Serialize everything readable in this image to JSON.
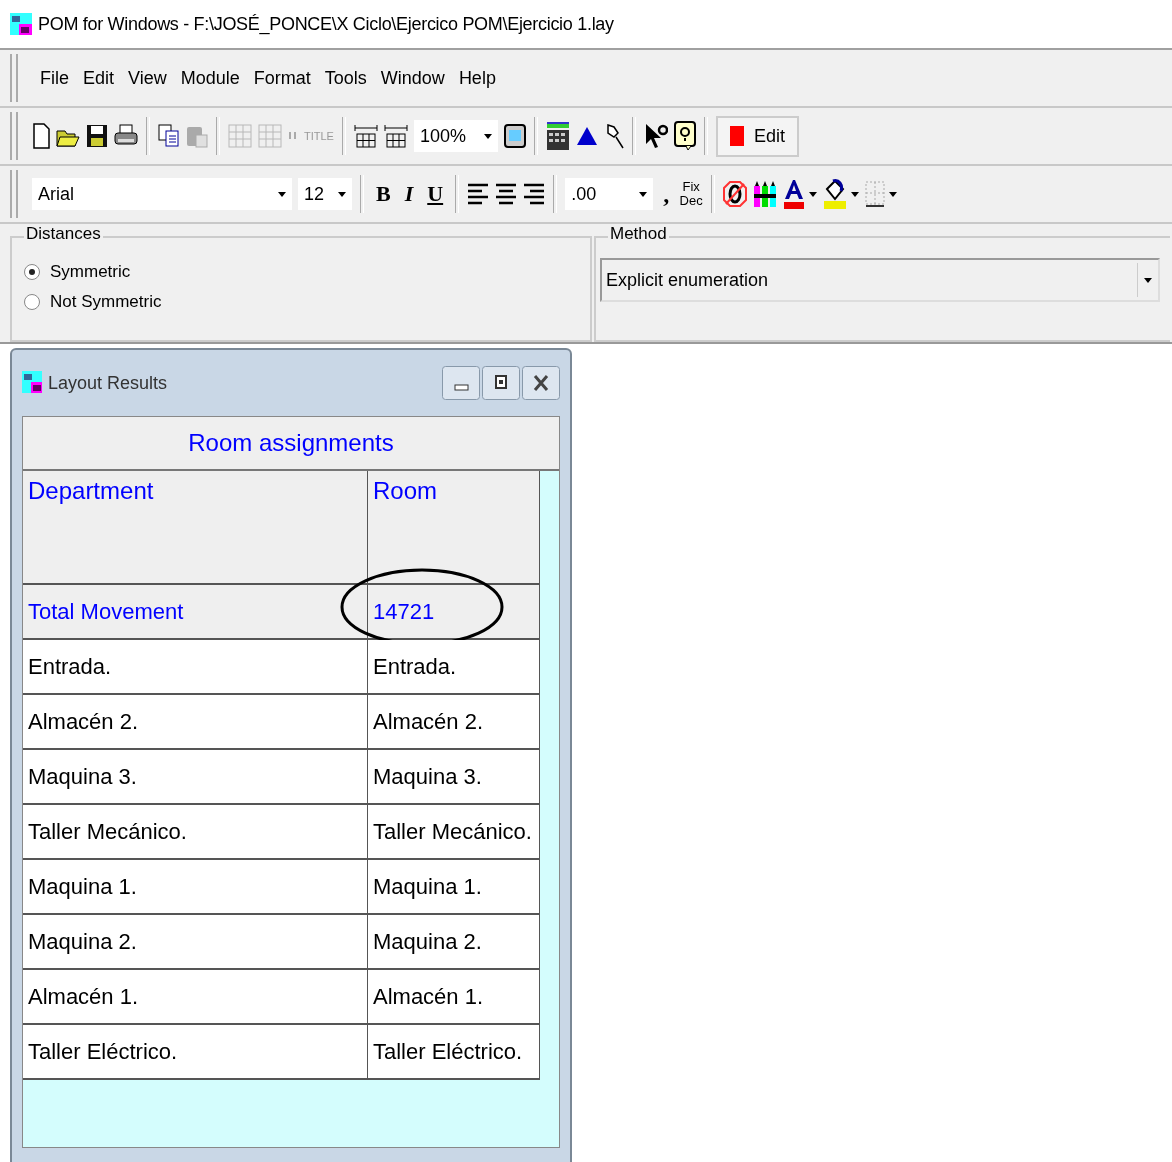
{
  "window": {
    "title": "POM for Windows - F:\\JOSÉ_PONCE\\X Ciclo\\Ejercico POM\\Ejercicio 1.lay"
  },
  "menu": [
    "File",
    "Edit",
    "View",
    "Module",
    "Format",
    "Tools",
    "Window",
    "Help"
  ],
  "toolbar": {
    "title_button": "TITLE",
    "zoom": "100%",
    "edit_button": "Edit"
  },
  "format_bar": {
    "font": "Arial",
    "size": "12",
    "bold": "B",
    "italic": "I",
    "underline": "U",
    "decimals": ".00",
    "comma": ",",
    "fix_decimals": "Fix Dec"
  },
  "distances": {
    "label": "Distances",
    "options": [
      {
        "label": "Symmetric",
        "selected": true
      },
      {
        "label": "Not Symmetric",
        "selected": false
      }
    ]
  },
  "method": {
    "label": "Method",
    "value": "Explicit enumeration"
  },
  "results_window": {
    "title": "Layout Results",
    "table": {
      "title": "Room assignments",
      "columns": [
        "Department",
        "Room"
      ],
      "rows": [
        {
          "kind": "total",
          "department": "Total Movement",
          "room": "14721",
          "circled": true
        },
        {
          "kind": "assignment",
          "department": "Entrada.",
          "room": "Entrada.",
          "circled": false
        },
        {
          "kind": "assignment",
          "department": "Almacén 2.",
          "room": "Almacén 2.",
          "circled": false
        },
        {
          "kind": "assignment",
          "department": "Maquina 3.",
          "room": "Maquina 3.",
          "circled": false
        },
        {
          "kind": "assignment",
          "department": "Taller Mecánico.",
          "room": "Taller Mecánico.",
          "circled": false
        },
        {
          "kind": "assignment",
          "department": "Maquina 1.",
          "room": "Maquina 1.",
          "circled": false
        },
        {
          "kind": "assignment",
          "department": "Maquina 2.",
          "room": "Maquina 2.",
          "circled": false
        },
        {
          "kind": "assignment",
          "department": "Almacén 1.",
          "room": "Almacén 1.",
          "circled": false
        },
        {
          "kind": "assignment",
          "department": "Taller Eléctrico.",
          "room": "Taller Eléctrico.",
          "circled": false
        }
      ]
    }
  }
}
